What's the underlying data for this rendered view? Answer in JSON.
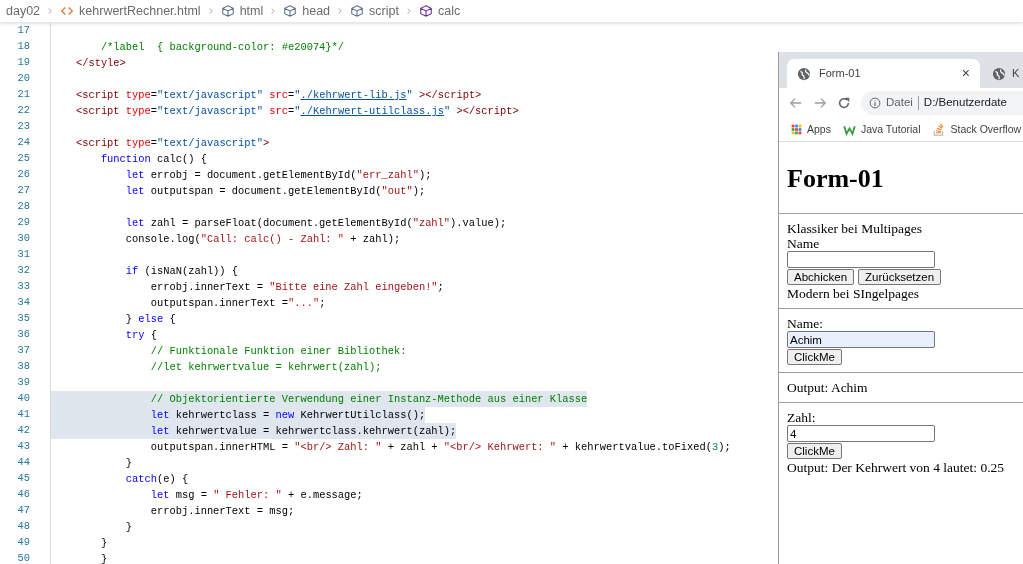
{
  "breadcrumb": [
    {
      "kind": "folder",
      "label": "day02"
    },
    {
      "kind": "file",
      "label": "kehrwertRechner.html"
    },
    {
      "kind": "element",
      "label": "html"
    },
    {
      "kind": "element",
      "label": "head"
    },
    {
      "kind": "element",
      "label": "script"
    },
    {
      "kind": "function",
      "label": "calc"
    }
  ],
  "editor": {
    "lines": [
      {
        "number": "17",
        "highlighted": false
      },
      {
        "number": "18",
        "highlighted": false,
        "tokens": [
          {
            "kind": "comment",
            "text": "        /*label  { background-color: #e20074}*/"
          }
        ]
      },
      {
        "number": "19",
        "highlighted": false,
        "tokens": [
          {
            "kind": "tag",
            "text": "    </style>"
          }
        ]
      },
      {
        "number": "20",
        "highlighted": false
      },
      {
        "number": "21",
        "highlighted": false,
        "tokens": [
          {
            "kind": "tag",
            "text": "    <script"
          },
          {
            "kind": "attr",
            "text": " type"
          },
          {
            "kind": "plain",
            "text": "="
          },
          {
            "kind": "value",
            "text": "\"text/javascript\""
          },
          {
            "kind": "attr",
            "text": " src"
          },
          {
            "kind": "plain",
            "text": "="
          },
          {
            "kind": "value",
            "text": "\""
          },
          {
            "kind": "link",
            "text": "./kehrwert-lib.js"
          },
          {
            "kind": "value",
            "text": "\""
          },
          {
            "kind": "tag",
            "text": " ></script>"
          }
        ]
      },
      {
        "number": "22",
        "highlighted": false,
        "tokens": [
          {
            "kind": "tag",
            "text": "    <script"
          },
          {
            "kind": "attr",
            "text": " type"
          },
          {
            "kind": "plain",
            "text": "="
          },
          {
            "kind": "value",
            "text": "\"text/javascript\""
          },
          {
            "kind": "attr",
            "text": " src"
          },
          {
            "kind": "plain",
            "text": "="
          },
          {
            "kind": "value",
            "text": "\""
          },
          {
            "kind": "link",
            "text": "./Kehrwert-utilclass.js"
          },
          {
            "kind": "value",
            "text": "\""
          },
          {
            "kind": "tag",
            "text": " ></script>"
          }
        ]
      },
      {
        "number": "23",
        "highlighted": false
      },
      {
        "number": "24",
        "highlighted": false,
        "tokens": [
          {
            "kind": "tag",
            "text": "    <script"
          },
          {
            "kind": "attr",
            "text": " type"
          },
          {
            "kind": "plain",
            "text": "="
          },
          {
            "kind": "value",
            "text": "\"text/javascript\""
          },
          {
            "kind": "tag",
            "text": ">"
          }
        ]
      },
      {
        "number": "25",
        "highlighted": false,
        "tokens": [
          {
            "kind": "keyword",
            "text": "        function"
          },
          {
            "kind": "plain",
            "text": " calc() {"
          }
        ]
      },
      {
        "number": "26",
        "highlighted": false,
        "tokens": [
          {
            "kind": "keyword",
            "text": "            let"
          },
          {
            "kind": "plain",
            "text": " errobj = document.getElementById("
          },
          {
            "kind": "string",
            "text": "\"err_zahl\""
          },
          {
            "kind": "plain",
            "text": ");"
          }
        ]
      },
      {
        "number": "27",
        "highlighted": false,
        "tokens": [
          {
            "kind": "keyword",
            "text": "            let"
          },
          {
            "kind": "plain",
            "text": " outputspan = document.getElementById("
          },
          {
            "kind": "string",
            "text": "\"out\""
          },
          {
            "kind": "plain",
            "text": ");"
          }
        ]
      },
      {
        "number": "28",
        "highlighted": false
      },
      {
        "number": "29",
        "highlighted": false,
        "tokens": [
          {
            "kind": "keyword",
            "text": "            let"
          },
          {
            "kind": "plain",
            "text": " zahl = parseFloat(document.getElementById("
          },
          {
            "kind": "string",
            "text": "\"zahl\""
          },
          {
            "kind": "plain",
            "text": ").value);"
          }
        ]
      },
      {
        "number": "30",
        "highlighted": false,
        "tokens": [
          {
            "kind": "plain",
            "text": "            console.log("
          },
          {
            "kind": "string",
            "text": "\"Call: calc() - Zahl: \""
          },
          {
            "kind": "plain",
            "text": " + zahl);"
          }
        ]
      },
      {
        "number": "31",
        "highlighted": false
      },
      {
        "number": "32",
        "highlighted": false,
        "tokens": [
          {
            "kind": "keyword",
            "text": "            if"
          },
          {
            "kind": "plain",
            "text": " (isNaN(zahl)) {"
          }
        ]
      },
      {
        "number": "33",
        "highlighted": false,
        "tokens": [
          {
            "kind": "plain",
            "text": "                errobj.innerText = "
          },
          {
            "kind": "string",
            "text": "\"Bitte eine Zahl eingeben!\""
          },
          {
            "kind": "plain",
            "text": ";"
          }
        ]
      },
      {
        "number": "34",
        "highlighted": false,
        "tokens": [
          {
            "kind": "plain",
            "text": "                outputspan.innerText ="
          },
          {
            "kind": "string",
            "text": "\"...\""
          },
          {
            "kind": "plain",
            "text": ";"
          }
        ]
      },
      {
        "number": "35",
        "highlighted": false,
        "tokens": [
          {
            "kind": "plain",
            "text": "            } "
          },
          {
            "kind": "keyword",
            "text": "else"
          },
          {
            "kind": "plain",
            "text": " {"
          }
        ]
      },
      {
        "number": "36",
        "highlighted": false,
        "tokens": [
          {
            "kind": "keyword",
            "text": "            try"
          },
          {
            "kind": "plain",
            "text": " {"
          }
        ]
      },
      {
        "number": "37",
        "highlighted": false,
        "tokens": [
          {
            "kind": "comment",
            "text": "                // Funktionale Funktion einer Bibliothek:"
          }
        ]
      },
      {
        "number": "38",
        "highlighted": false,
        "tokens": [
          {
            "kind": "comment",
            "text": "                //let kehrwertvalue = kehrwert(zahl);"
          }
        ]
      },
      {
        "number": "39",
        "highlighted": false
      },
      {
        "number": "40",
        "highlighted": true,
        "tokens": [
          {
            "kind": "comment",
            "text": "                // Objektorientierte Verwendung einer Instanz-Methode aus einer Klasse"
          }
        ]
      },
      {
        "number": "41",
        "highlighted": true,
        "tokens": [
          {
            "kind": "keyword",
            "text": "                let"
          },
          {
            "kind": "plain",
            "text": " kehrwertclass = "
          },
          {
            "kind": "keyword",
            "text": "new"
          },
          {
            "kind": "plain",
            "text": " KehrwertUtilclass();"
          }
        ]
      },
      {
        "number": "42",
        "highlighted": true,
        "tokens": [
          {
            "kind": "keyword",
            "text": "                let"
          },
          {
            "kind": "plain",
            "text": " kehrwertvalue = kehrwertclass.kehrwert(zahl);"
          }
        ]
      },
      {
        "number": "43",
        "highlighted": false,
        "tokens": [
          {
            "kind": "plain",
            "text": "                outputspan.innerHTML = "
          },
          {
            "kind": "string",
            "text": "\"<br/> Zahl: \""
          },
          {
            "kind": "plain",
            "text": " + zahl + "
          },
          {
            "kind": "string",
            "text": "\"<br/> Kehrwert: \""
          },
          {
            "kind": "plain",
            "text": " + kehrwertvalue.toFixed("
          },
          {
            "kind": "number",
            "text": "3"
          },
          {
            "kind": "plain",
            "text": ");"
          }
        ]
      },
      {
        "number": "44",
        "highlighted": false,
        "tokens": [
          {
            "kind": "plain",
            "text": "            }"
          }
        ]
      },
      {
        "number": "45",
        "highlighted": false,
        "tokens": [
          {
            "kind": "keyword",
            "text": "            catch"
          },
          {
            "kind": "plain",
            "text": "(e) {"
          }
        ]
      },
      {
        "number": "46",
        "highlighted": false,
        "tokens": [
          {
            "kind": "keyword",
            "text": "                let"
          },
          {
            "kind": "plain",
            "text": " msg = "
          },
          {
            "kind": "string",
            "text": "\" Fehler: \""
          },
          {
            "kind": "plain",
            "text": " + e.message;"
          }
        ]
      },
      {
        "number": "47",
        "highlighted": false,
        "tokens": [
          {
            "kind": "plain",
            "text": "                errobj.innerText = msg;"
          }
        ]
      },
      {
        "number": "48",
        "highlighted": false,
        "tokens": [
          {
            "kind": "plain",
            "text": "            }"
          }
        ]
      },
      {
        "number": "49",
        "highlighted": false,
        "tokens": [
          {
            "kind": "plain",
            "text": "        }"
          }
        ]
      },
      {
        "number": "50",
        "highlighted": false,
        "tokens": [
          {
            "kind": "plain",
            "text": "        }"
          }
        ]
      }
    ]
  },
  "browser": {
    "tabs": [
      {
        "title": "Form-01",
        "selected": true,
        "close": "×"
      },
      {
        "title": "K",
        "selected": false
      }
    ],
    "address": {
      "scheme": "Datei",
      "url": "D:/Benutzerdate"
    },
    "bookmarks": [
      {
        "kind": "apps",
        "label": "Apps"
      },
      {
        "kind": "tutorial",
        "label": "Java Tutorial"
      },
      {
        "kind": "stack",
        "label": "Stack Overflow"
      }
    ],
    "page": [
      {
        "kind": "heading",
        "text": "Form-01"
      },
      {
        "kind": "rule"
      },
      {
        "kind": "text",
        "text": "Klassiker bei Multipages"
      },
      {
        "kind": "text",
        "text": "Name"
      },
      {
        "kind": "input",
        "autofilled": false
      },
      {
        "kind": "buttons",
        "labels": [
          "Abchicken",
          "Zurücksetzen"
        ]
      },
      {
        "kind": "text",
        "text": "Modern bei SIngelpages"
      },
      {
        "kind": "rule"
      },
      {
        "kind": "text",
        "text": "Name:"
      },
      {
        "kind": "input",
        "value": "Achim",
        "autofilled": true
      },
      {
        "kind": "buttons",
        "labels": [
          "ClickMe"
        ]
      },
      {
        "kind": "rule"
      },
      {
        "kind": "text",
        "text": "Output: Achim"
      },
      {
        "kind": "rule"
      },
      {
        "kind": "text",
        "text": "Zahl:"
      },
      {
        "kind": "input",
        "value": "4",
        "autofilled": false
      },
      {
        "kind": "buttons",
        "labels": [
          "ClickMe"
        ]
      },
      {
        "kind": "text",
        "text": "Output: Der Kehrwert von 4 lautet: 0.25"
      }
    ]
  }
}
